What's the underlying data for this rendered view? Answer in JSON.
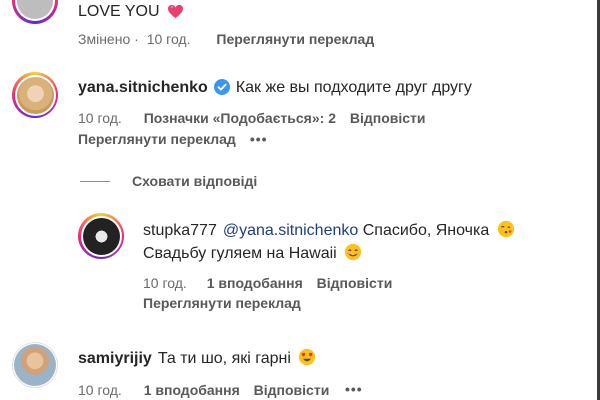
{
  "comments": {
    "c0": {
      "text": "LOVE YOU",
      "emoji": "heart-emoji",
      "edited": "Змінено",
      "sep": "·",
      "time": "10 год.",
      "translate": "Переглянути переклад"
    },
    "c1": {
      "username": "yana.sitnichenko",
      "verified": true,
      "text": "Как же вы подходите друг другу",
      "time": "10 год.",
      "likes": "Позначки «Подобається»: 2",
      "reply": "Відповісти",
      "translate": "Переглянути переклад",
      "more": "•••"
    },
    "hide_replies": "Сховати відповіді",
    "c2": {
      "username": "stupka777",
      "mention": "@yana.sitnichenko",
      "text_a": "Спасибо, Яночка",
      "text_b": "Свадьбу гуляем на Hawaii",
      "emoji_a": "kissing-face-emoji",
      "emoji_b": "smiling-face-emoji",
      "time": "10 год.",
      "likes": "1 вподобання",
      "reply": "Відповісти",
      "translate": "Переглянути переклад"
    },
    "c3": {
      "username": "samiyrijiy",
      "text": "Та ти шо, які гарні",
      "emoji": "heart-eyes-emoji",
      "time": "10 год.",
      "likes": "1 вподобання",
      "reply": "Відповісти",
      "more": "•••"
    }
  },
  "colors": {
    "verified": "#3897f0",
    "ring_start": "#f9ce34",
    "ring_mid": "#ee2a7b",
    "ring_end": "#6228d7"
  }
}
